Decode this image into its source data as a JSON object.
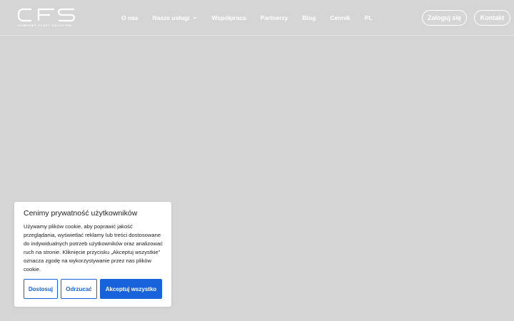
{
  "logo": {
    "text": "CFS",
    "tagline": "COMFORT FLEET SOLUTION"
  },
  "nav": {
    "items": [
      {
        "label": "O nas",
        "dropdown": false
      },
      {
        "label": "Nasze usługi",
        "dropdown": true
      },
      {
        "label": "Współpraca",
        "dropdown": false
      },
      {
        "label": "Partnerzy",
        "dropdown": false
      },
      {
        "label": "Blog",
        "dropdown": false
      },
      {
        "label": "Cennik",
        "dropdown": false
      },
      {
        "label": "PL",
        "dropdown": false
      }
    ],
    "login_label": "Zaloguj się",
    "contact_label": "Kontakt"
  },
  "cookie": {
    "title": "Cenimy prywatność użytkowników",
    "text": "Używamy plików cookie, aby poprawić jakość przeglądania, wyświetlać reklamy lub treści dostosowane do indywidualnych potrzeb użytkowników oraz analizować ruch na stronie. Kliknięcie przycisku „Akceptuj wszystkie” oznacza zgodę na wykorzystywanie przez nas plików cookie.",
    "customize_label": "Dostosuj",
    "reject_label": "Odrzucać",
    "accept_label": "Akceptuj wszystko"
  },
  "colors": {
    "background": "#d5d5d5",
    "accent": "#1863dc",
    "header_text": "#ffffff"
  },
  "icons": {
    "dropdown": "chevron-down-icon"
  }
}
